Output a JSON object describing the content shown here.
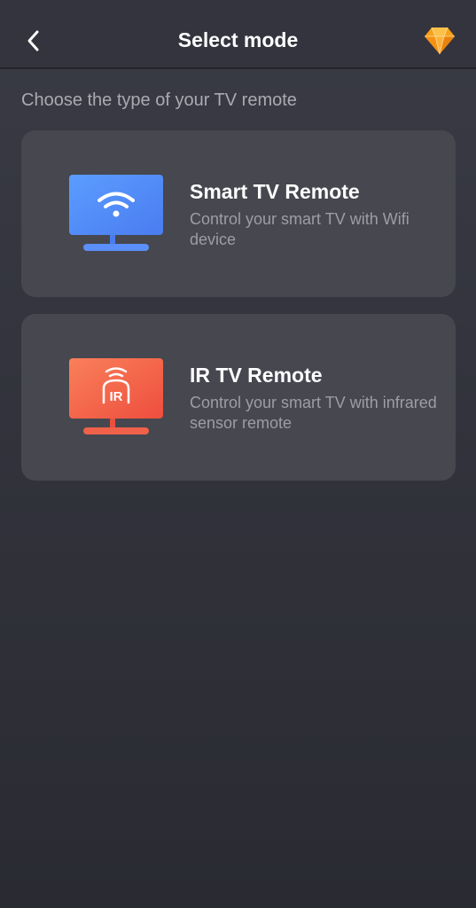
{
  "header": {
    "title": "Select mode",
    "back_icon": "chevron-left-icon",
    "premium_icon": "diamond-icon",
    "premium_color": "#f7a21a"
  },
  "subtitle": "Choose the type of your TV remote",
  "modes": [
    {
      "title": "Smart TV Remote",
      "description": "Control your smart TV with Wifi device",
      "icon": "smart-tv-wifi-icon",
      "accent": "#5b8ff9"
    },
    {
      "title": "IR TV Remote",
      "description": "Control your smart TV with infrared sensor remote",
      "icon": "ir-tv-icon",
      "icon_text": "IR",
      "accent": "#f0614a"
    }
  ]
}
